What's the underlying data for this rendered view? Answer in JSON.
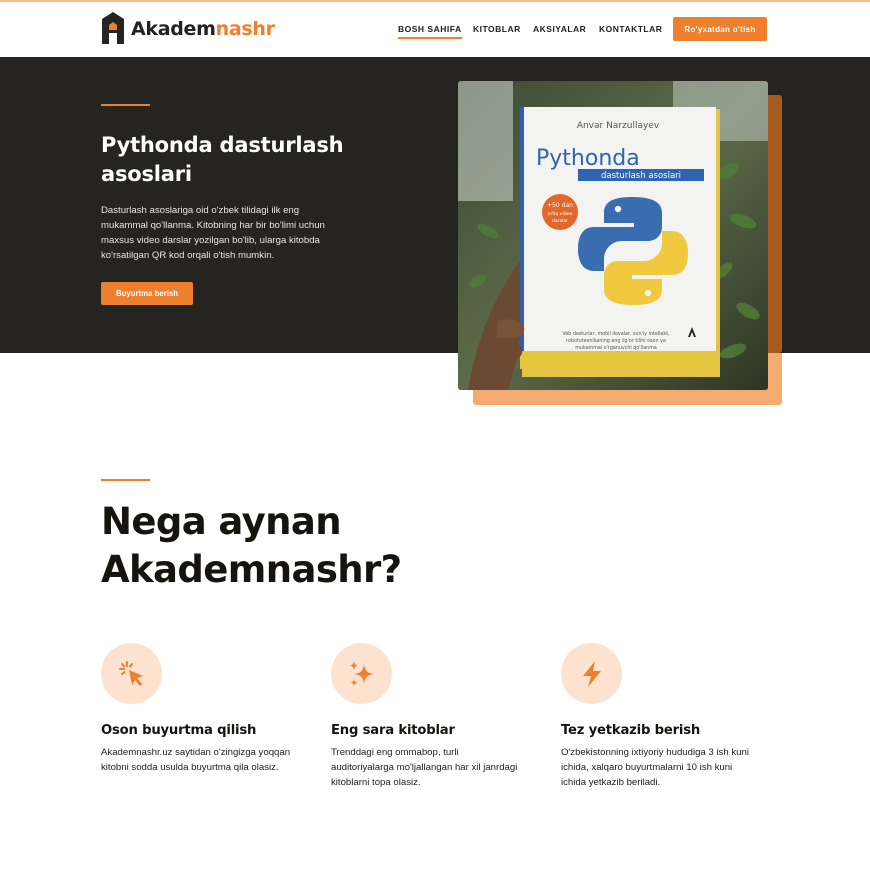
{
  "brand": {
    "name_part1": "Akadem",
    "name_part2": "nashr",
    "accent_color": "#ee7f2d",
    "dark_bg": "#262421"
  },
  "nav": {
    "items": [
      {
        "label": "BOSH SAHIFA",
        "active": true
      },
      {
        "label": "KITOBLAR"
      },
      {
        "label": "AKSIYALAR"
      },
      {
        "label": "KONTAKTLAR"
      }
    ],
    "register_label": "Ro'yxatdan o'tish"
  },
  "hero": {
    "title": "Pythonda dasturlash asoslari",
    "description": "Dasturlash asoslariga oid o'zbek tilidagi ilk eng mukammal qo'llanma. Kitobning har bir bo'limi uchun maxsus video darslar yozilgan bo'lib, ularga kitobda ko'rsatilgan QR kod orqali o'tish mumkin.",
    "cta_label": "Buyurtma berish",
    "book": {
      "author": "Anvar Narzullayev",
      "title_main": "Pythonda",
      "title_sub": "dasturlash asoslari",
      "badge_line1": "+50 dan",
      "badge_line2": "ortiq video",
      "badge_line3": "darslar",
      "blurb_line1": "Veb dasturlar, mobil ilovalar, sun'iy intellekt,",
      "blurb_line2": "robototexnikaning eng ilg'or tilini oson va",
      "blurb_line3": "mukammal o'rganuvchi qo'llanma"
    }
  },
  "why": {
    "title_line1": "Nega aynan",
    "title_line2": "Akademnashr?",
    "features": [
      {
        "icon": "cursor-click-icon",
        "title": "Oson buyurtma qilish",
        "text": "Akademnashr.uz saytidan o'zingizga yoqqan kitobni sodda usulda buyurtma qila olasiz."
      },
      {
        "icon": "sparkles-icon",
        "title": "Eng sara kitoblar",
        "text": "Trenddagi eng ommabop, turli auditoriyalarga mo'ljallangan har xil janrdagi kitoblarni topa olasiz."
      },
      {
        "icon": "lightning-icon",
        "title": "Tez yetkazib berish",
        "text": "O'zbekistonning ixtiyoriy hududiga 3 ish kuni ichida, xalqaro buyurtmalarni 10 ish kuni ichida yetkazib beriladi."
      }
    ]
  }
}
